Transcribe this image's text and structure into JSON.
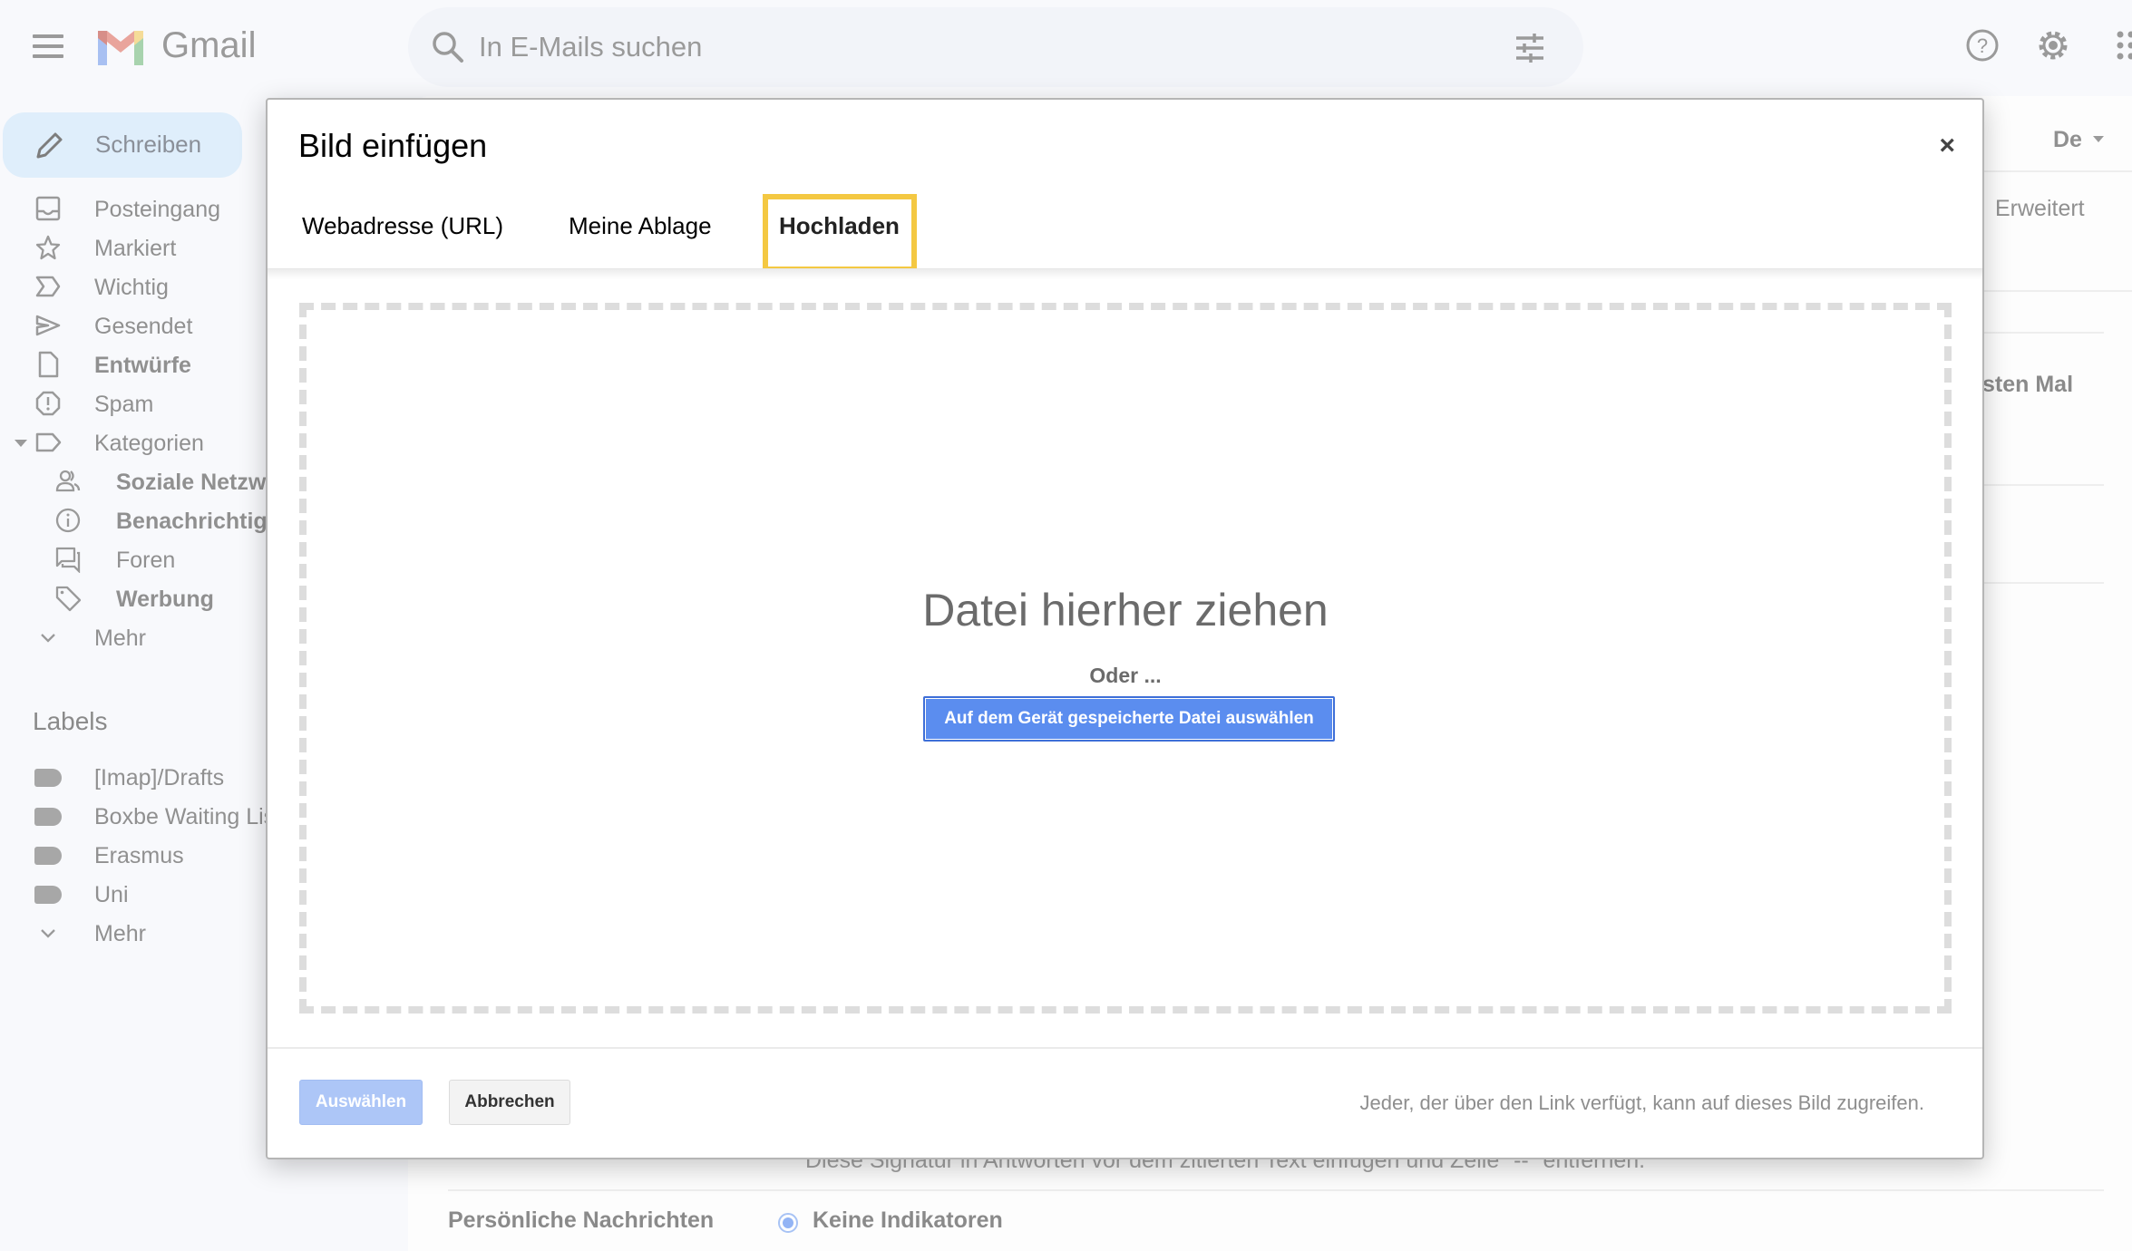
{
  "app": {
    "name": "Gmail",
    "search_placeholder": "In E-Mails suchen"
  },
  "sidebar": {
    "compose_label": "Schreiben",
    "items": [
      {
        "label": "Posteingang",
        "icon": "inbox-icon",
        "bold": false
      },
      {
        "label": "Markiert",
        "icon": "star-icon",
        "bold": false
      },
      {
        "label": "Wichtig",
        "icon": "important-icon",
        "bold": false
      },
      {
        "label": "Gesendet",
        "icon": "send-icon",
        "bold": false
      },
      {
        "label": "Entwürfe",
        "icon": "draft-icon",
        "bold": true
      },
      {
        "label": "Spam",
        "icon": "spam-icon",
        "bold": false
      },
      {
        "label": "Kategorien",
        "icon": "label-icon",
        "bold": false
      }
    ],
    "categories": [
      {
        "label": "Soziale Netzwerke",
        "icon": "people-icon",
        "bold": true
      },
      {
        "label": "Benachrichtigungen",
        "icon": "info-icon",
        "bold": true
      },
      {
        "label": "Foren",
        "icon": "forum-icon",
        "bold": false
      },
      {
        "label": "Werbung",
        "icon": "tag-icon",
        "bold": true
      }
    ],
    "more_label": "Mehr",
    "labels_title": "Labels",
    "labels": [
      {
        "label": "[Imap]/Drafts"
      },
      {
        "label": "Boxbe Waiting List"
      },
      {
        "label": "Erasmus"
      },
      {
        "label": "Uni"
      }
    ],
    "labels_more": "Mehr"
  },
  "background": {
    "language_short": "De",
    "advanced_tab": "Erweitert",
    "partial_text": "sten Mal",
    "signature_text": "Diese Signatur in Antworten vor dem zitierten Text einfügen und Zeile \"--\" entfernen.",
    "personal_messages_label": "Persönliche Nachrichten",
    "personal_messages_value": "Keine Indikatoren"
  },
  "dialog": {
    "title": "Bild einfügen",
    "close_label": "×",
    "tabs": [
      {
        "label": "Webadresse (URL)",
        "active": false
      },
      {
        "label": "Meine Ablage",
        "active": false
      },
      {
        "label": "Hochladen",
        "active": true
      }
    ],
    "dropzone_title": "Datei hierher ziehen",
    "dropzone_or": "Oder ...",
    "choose_file_button": "Auf dem Gerät gespeicherte Datei auswählen",
    "select_button": "Auswählen",
    "cancel_button": "Abbrechen",
    "footer_note": "Jeder, der über den Link verfügt, kann auf dieses Bild zugreifen."
  },
  "colors": {
    "highlight": "#f4c842",
    "primary_button": "#5b8def",
    "disabled_button": "#adc6f7",
    "compose_bg": "#dfeefb"
  }
}
